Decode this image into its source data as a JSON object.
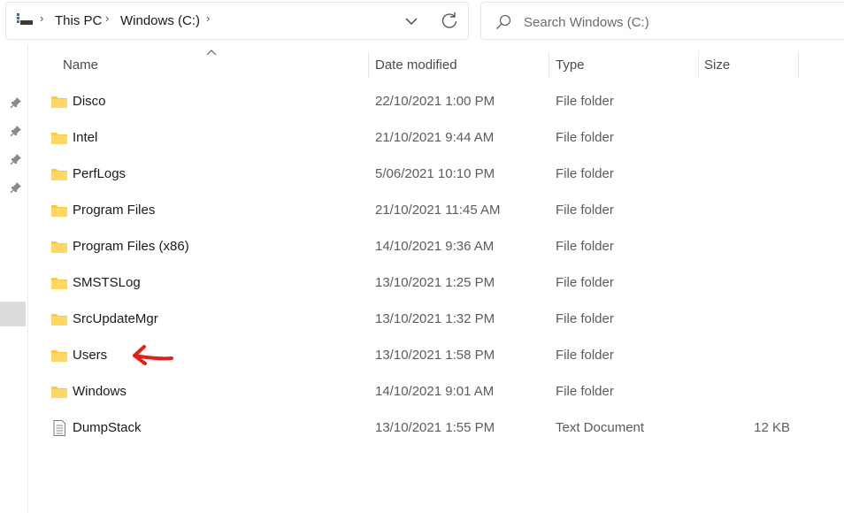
{
  "address": {
    "crumbs": [
      "This PC",
      "Windows (C:)"
    ]
  },
  "search": {
    "placeholder": "Search Windows (C:)"
  },
  "columns": {
    "name": "Name",
    "date": "Date modified",
    "type": "Type",
    "size": "Size"
  },
  "files": [
    {
      "name": "Disco",
      "date": "22/10/2021 1:00 PM",
      "type": "File folder",
      "size": "",
      "icon": "folder-icon"
    },
    {
      "name": "Intel",
      "date": "21/10/2021 9:44 AM",
      "type": "File folder",
      "size": "",
      "icon": "folder-icon"
    },
    {
      "name": "PerfLogs",
      "date": "5/06/2021 10:10 PM",
      "type": "File folder",
      "size": "",
      "icon": "folder-icon"
    },
    {
      "name": "Program Files",
      "date": "21/10/2021 11:45 AM",
      "type": "File folder",
      "size": "",
      "icon": "folder-icon"
    },
    {
      "name": "Program Files (x86)",
      "date": "14/10/2021 9:36 AM",
      "type": "File folder",
      "size": "",
      "icon": "folder-icon"
    },
    {
      "name": "SMSTSLog",
      "date": "13/10/2021 1:25 PM",
      "type": "File folder",
      "size": "",
      "icon": "folder-icon"
    },
    {
      "name": "SrcUpdateMgr",
      "date": "13/10/2021 1:32 PM",
      "type": "File folder",
      "size": "",
      "icon": "folder-icon"
    },
    {
      "name": "Users",
      "date": "13/10/2021 1:58 PM",
      "type": "File folder",
      "size": "",
      "icon": "folder-icon"
    },
    {
      "name": "Windows",
      "date": "14/10/2021 9:01 AM",
      "type": "File folder",
      "size": "",
      "icon": "folder-icon"
    },
    {
      "name": "DumpStack",
      "date": "13/10/2021 1:55 PM",
      "type": "Text Document",
      "size": "12 KB",
      "icon": "text-document-icon"
    }
  ],
  "colors": {
    "folder": "#ffc83d",
    "annotation": "#e0201b"
  }
}
